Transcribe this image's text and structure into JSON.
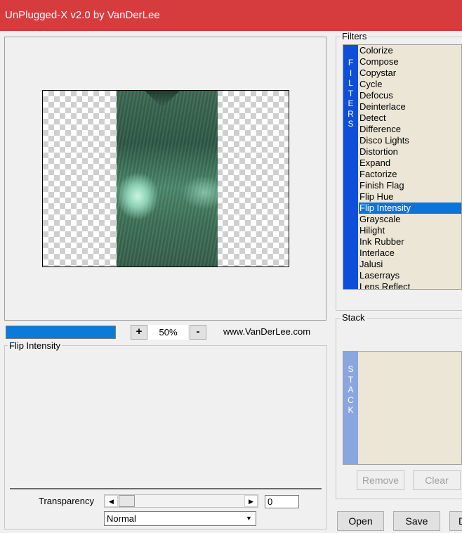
{
  "window": {
    "title": "UnPlugged-X v2.0 by VanDerLee"
  },
  "preview": {
    "progress": 1.0,
    "zoom_in_label": "+",
    "zoom_value": "50%",
    "zoom_out_label": "-",
    "website": "www.VanDerLee.com"
  },
  "filter_panel": {
    "group_label": "Flip Intensity",
    "transparency_label": "Transparency",
    "transparency_value": "0",
    "blend_mode": "Normal"
  },
  "filters": {
    "group_label": "Filters",
    "strip_letters": [
      "F",
      "I",
      "L",
      "T",
      "E",
      "R",
      "S"
    ],
    "strip_color": "#0e4fd9",
    "selected": "Flip Intensity",
    "items": [
      "Colorize",
      "Compose",
      "Copystar",
      "Cycle",
      "Defocus",
      "Deinterlace",
      "Detect",
      "Difference",
      "Disco Lights",
      "Distortion",
      "Expand",
      "Factorize",
      "Finish Flag",
      "Flip Hue",
      "Flip Intensity",
      "Grayscale",
      "Hilight",
      "Ink Rubber",
      "Interlace",
      "Jalusi",
      "Laserrays",
      "Lens Reflect"
    ]
  },
  "stack": {
    "group_label": "Stack",
    "strip_letters": [
      "S",
      "T",
      "A",
      "C",
      "K"
    ],
    "strip_color": "#8aa6e0",
    "remove_label": "Remove",
    "clear_label": "Clear"
  },
  "footer": {
    "open_label": "Open",
    "save_label": "Save",
    "partial_label": "D"
  }
}
